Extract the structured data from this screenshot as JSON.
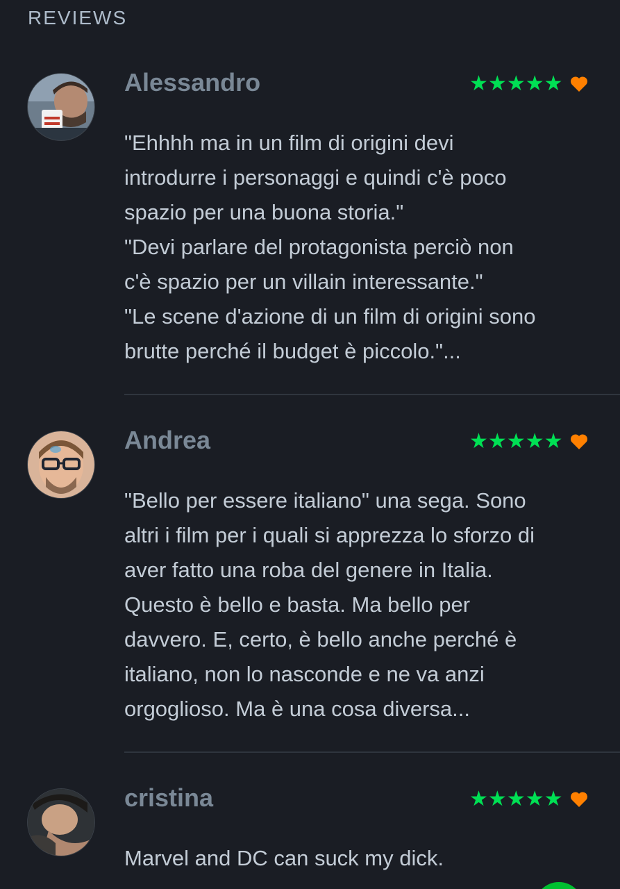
{
  "section": {
    "title": "REVIEWS"
  },
  "colors": {
    "background": "#1a1d24",
    "star": "#00e054",
    "heart": "#ff8000",
    "name": "#7a8896",
    "text": "#c3ccd6"
  },
  "reviews": [
    {
      "reviewer": "Alessandro",
      "rating": 5,
      "liked": true,
      "avatar_icon": "avatar-mug-photo",
      "text": "\"Ehhhh ma in un film di origini devi\nintrodurre i personaggi e quindi c'è poco\nspazio per una buona storia.\"\n\"Devi parlare del protagonista perciò non\nc'è spazio per un villain interessante.\"\n\"Le scene d'azione di un film di origini sono\nbrutte perché il budget è piccolo.\"..."
    },
    {
      "reviewer": "Andrea",
      "rating": 5,
      "liked": true,
      "avatar_icon": "avatar-glasses-photo",
      "text": "\"Bello per essere italiano\" una sega. Sono\naltri i film per i quali si apprezza lo sforzo di\naver fatto una roba del genere in Italia.\nQuesto è bello e basta. Ma bello per\ndavvero. E, certo, è bello anche perché è\nitaliano, non lo nasconde e ne va anzi\norgoglioso. Ma è una cosa diversa..."
    },
    {
      "reviewer": "cristina",
      "rating": 5,
      "liked": true,
      "avatar_icon": "avatar-portrait-photo",
      "text": "Marvel and DC can suck my dick."
    }
  ]
}
